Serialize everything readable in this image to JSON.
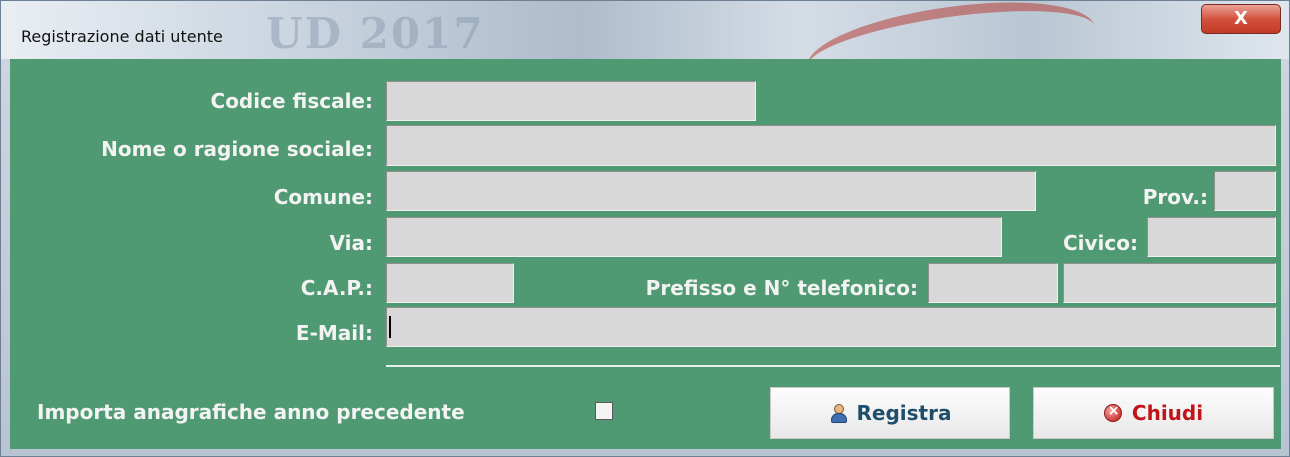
{
  "window": {
    "title": "Registrazione dati utente",
    "watermark": "UD 2017",
    "close_label": "X"
  },
  "form": {
    "codice_fiscale": {
      "label": "Codice fiscale:",
      "value": ""
    },
    "nome": {
      "label": "Nome o ragione sociale:",
      "value": ""
    },
    "comune": {
      "label": "Comune:",
      "value": ""
    },
    "prov": {
      "label": "Prov.:",
      "value": ""
    },
    "via": {
      "label": "Via:",
      "value": ""
    },
    "civico": {
      "label": "Civico:",
      "value": ""
    },
    "cap": {
      "label": "C.A.P.:",
      "value": ""
    },
    "telefono": {
      "label": "Prefisso e N° telefonico:",
      "prefix": "",
      "number": ""
    },
    "email": {
      "label": "E-Mail:",
      "value": ""
    }
  },
  "import": {
    "label": "Importa anagrafiche anno precedente",
    "checked": false
  },
  "buttons": {
    "registra": "Registra",
    "chiudi": "Chiudi"
  },
  "colors": {
    "panel": "#4f9a72",
    "registra_text": "#1f4e6b",
    "chiudi_text": "#c0141a"
  },
  "icons": {
    "registra": "user-icon",
    "chiudi": "stop-icon"
  }
}
